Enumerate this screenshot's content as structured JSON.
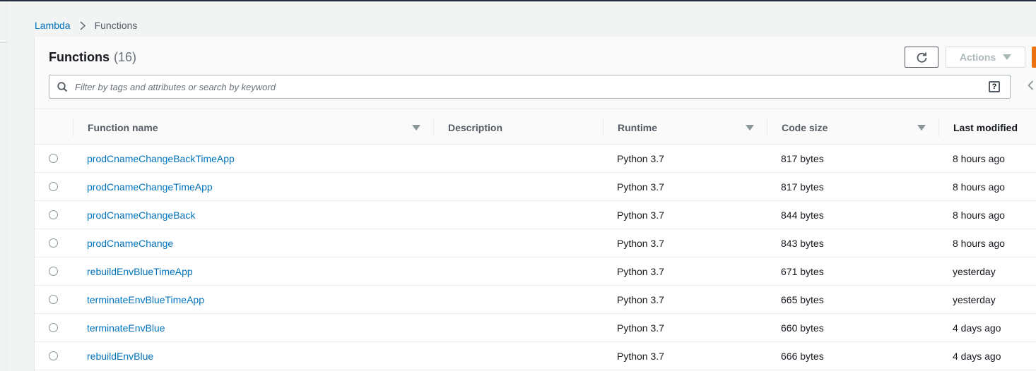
{
  "breadcrumb": {
    "root": "Lambda",
    "current": "Functions"
  },
  "panel": {
    "title": "Functions",
    "count": "(16)",
    "actions_label": "Actions",
    "search_placeholder": "Filter by tags and attributes or search by keyword",
    "help_glyph": "?"
  },
  "table": {
    "columns": [
      "Function name",
      "Description",
      "Runtime",
      "Code size",
      "Last modified"
    ],
    "rows": [
      {
        "name": "prodCnameChangeBackTimeApp",
        "description": "",
        "runtime": "Python 3.7",
        "code_size": "817 bytes",
        "last_modified": "8 hours ago"
      },
      {
        "name": "prodCnameChangeTimeApp",
        "description": "",
        "runtime": "Python 3.7",
        "code_size": "817 bytes",
        "last_modified": "8 hours ago"
      },
      {
        "name": "prodCnameChangeBack",
        "description": "",
        "runtime": "Python 3.7",
        "code_size": "844 bytes",
        "last_modified": "8 hours ago"
      },
      {
        "name": "prodCnameChange",
        "description": "",
        "runtime": "Python 3.7",
        "code_size": "843 bytes",
        "last_modified": "8 hours ago"
      },
      {
        "name": "rebuildEnvBlueTimeApp",
        "description": "",
        "runtime": "Python 3.7",
        "code_size": "671 bytes",
        "last_modified": "yesterday"
      },
      {
        "name": "terminateEnvBlueTimeApp",
        "description": "",
        "runtime": "Python 3.7",
        "code_size": "665 bytes",
        "last_modified": "yesterday"
      },
      {
        "name": "terminateEnvBlue",
        "description": "",
        "runtime": "Python 3.7",
        "code_size": "660 bytes",
        "last_modified": "4 days ago"
      },
      {
        "name": "rebuildEnvBlue",
        "description": "",
        "runtime": "Python 3.7",
        "code_size": "666 bytes",
        "last_modified": "4 days ago"
      }
    ]
  },
  "colors": {
    "link": "#0073bb",
    "primary_orange": "#ec7211",
    "header_dark": "#232f3e"
  },
  "icons": {
    "refresh": "refresh-icon",
    "search": "search-icon",
    "sort": "caret-down-icon",
    "prev": "chevron-left-icon"
  }
}
